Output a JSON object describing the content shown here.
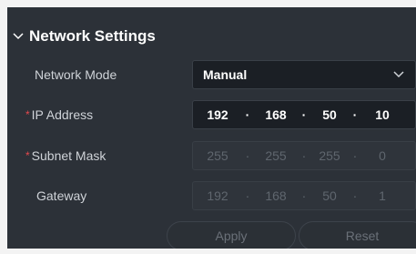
{
  "section": {
    "title": "Network Settings",
    "icon": "chevron-down-icon"
  },
  "network_mode": {
    "label": "Network Mode",
    "value": "Manual"
  },
  "ip_address": {
    "label": "IP Address",
    "required_marker": "*",
    "octets": [
      "192",
      "168",
      "50",
      "10"
    ],
    "separator": "·"
  },
  "subnet_mask": {
    "label": "Subnet Mask",
    "required_marker": "*",
    "octets": [
      "255",
      "255",
      "255",
      "0"
    ],
    "separator": "·"
  },
  "gateway": {
    "label": "Gateway",
    "octets": [
      "192",
      "168",
      "50",
      "1"
    ],
    "separator": "·"
  },
  "buttons": {
    "apply": "Apply",
    "reset": "Reset"
  },
  "colors": {
    "panel_bg": "#2c3138",
    "field_bg": "#1b1f25",
    "required": "#e5484d",
    "text": "#ffffff"
  }
}
